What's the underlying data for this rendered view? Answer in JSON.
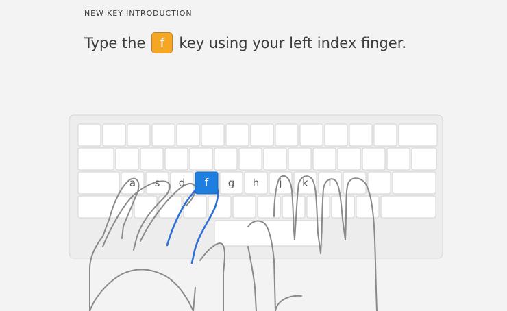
{
  "header": {
    "eyebrow": "NEW KEY INTRODUCTION",
    "instruction_before": "Type the",
    "target_key": "f",
    "instruction_after": "key using your left index finger."
  },
  "keyboard": {
    "home_row_labels": [
      "a",
      "s",
      "d",
      "f",
      "g",
      "h",
      "j",
      "k",
      "l"
    ],
    "active_key": "f",
    "active_color": "#1e7fe0",
    "chip_color": "#f5a623",
    "finger_highlight_color": "#2f6fd6"
  }
}
